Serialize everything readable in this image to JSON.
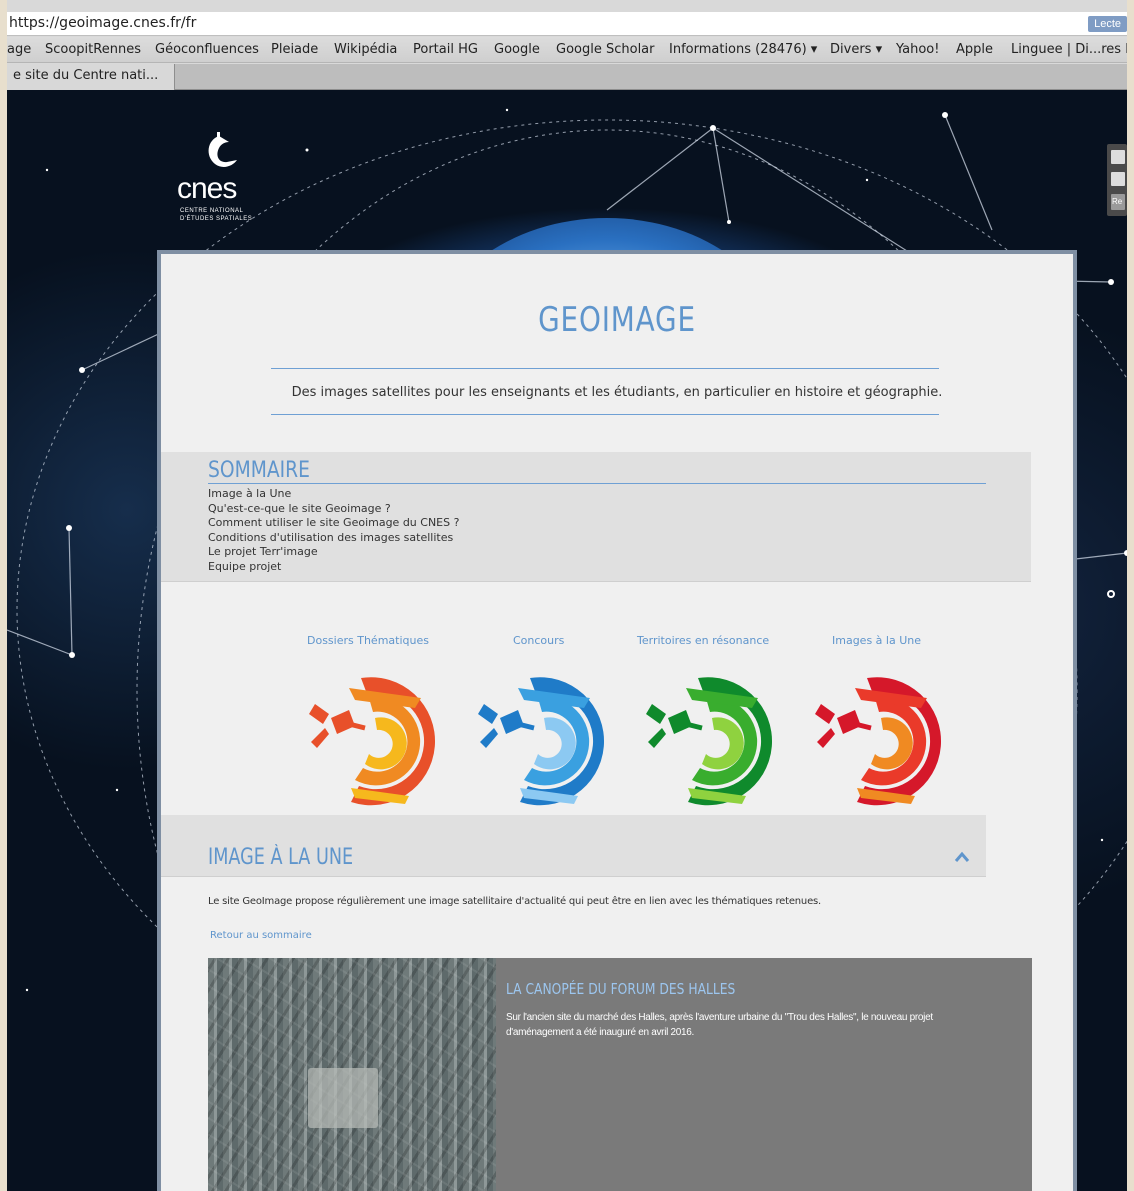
{
  "browser": {
    "url": "https://geoimage.cnes.fr/fr",
    "reader_button": "Lecte",
    "bookmarks": [
      "age",
      "ScoopitRennes",
      "Géoconfluences",
      "Pleiade",
      "Wikipédia",
      "Portail HG",
      "Google",
      "Google Scholar",
      "Informations (28476) ▾",
      "Divers ▾",
      "Yahoo!",
      "Apple",
      "Linguee | Di...res la"
    ],
    "tab_title": "e site du Centre nati..."
  },
  "logo": {
    "word": "cnes",
    "sub1": "CENTRE NATIONAL",
    "sub2": "D'ÉTUDES SPATIALES"
  },
  "side": {
    "re_label": "Re"
  },
  "page": {
    "title": "GEOIMAGE",
    "tagline": "Des images satellites pour les enseignants et les étudiants, en particulier en histoire et géographie."
  },
  "summary": {
    "heading": "SOMMAIRE",
    "items": [
      "Image à la Une",
      "Qu'est-ce-que le site Geoimage ?",
      "Comment utiliser le site Geoimage du CNES ?",
      "Conditions d'utilisation des images satellites",
      "Le projet Terr'image",
      "Equipe projet"
    ]
  },
  "sections": [
    {
      "label": "Dossiers Thématiques",
      "colors": [
        "#e8502a",
        "#f08a22",
        "#f6b81d"
      ]
    },
    {
      "label": "Concours",
      "colors": [
        "#1f7bc8",
        "#3aa0e0",
        "#8cc9f2"
      ]
    },
    {
      "label": "Territoires en résonance",
      "colors": [
        "#0f8a2c",
        "#39ad2e",
        "#8fd23f"
      ]
    },
    {
      "label": "Images à la Une",
      "colors": [
        "#d5182a",
        "#ea3a2a",
        "#f08a22"
      ]
    }
  ],
  "une": {
    "heading": "IMAGE À LA UNE",
    "text": "Le site GeoImage propose régulièrement une image satellitaire d'actualité qui peut être en lien avec les thématiques retenues.",
    "retour": "Retour au sommaire",
    "feature_title": "LA CANOPÉE DU FORUM DES HALLES",
    "feature_text": "Sur l'ancien site du marché des Halles, après l'aventure urbaine du \"Trou des Halles\", le nouveau projet d'aménagement a été inauguré en avril 2016."
  }
}
